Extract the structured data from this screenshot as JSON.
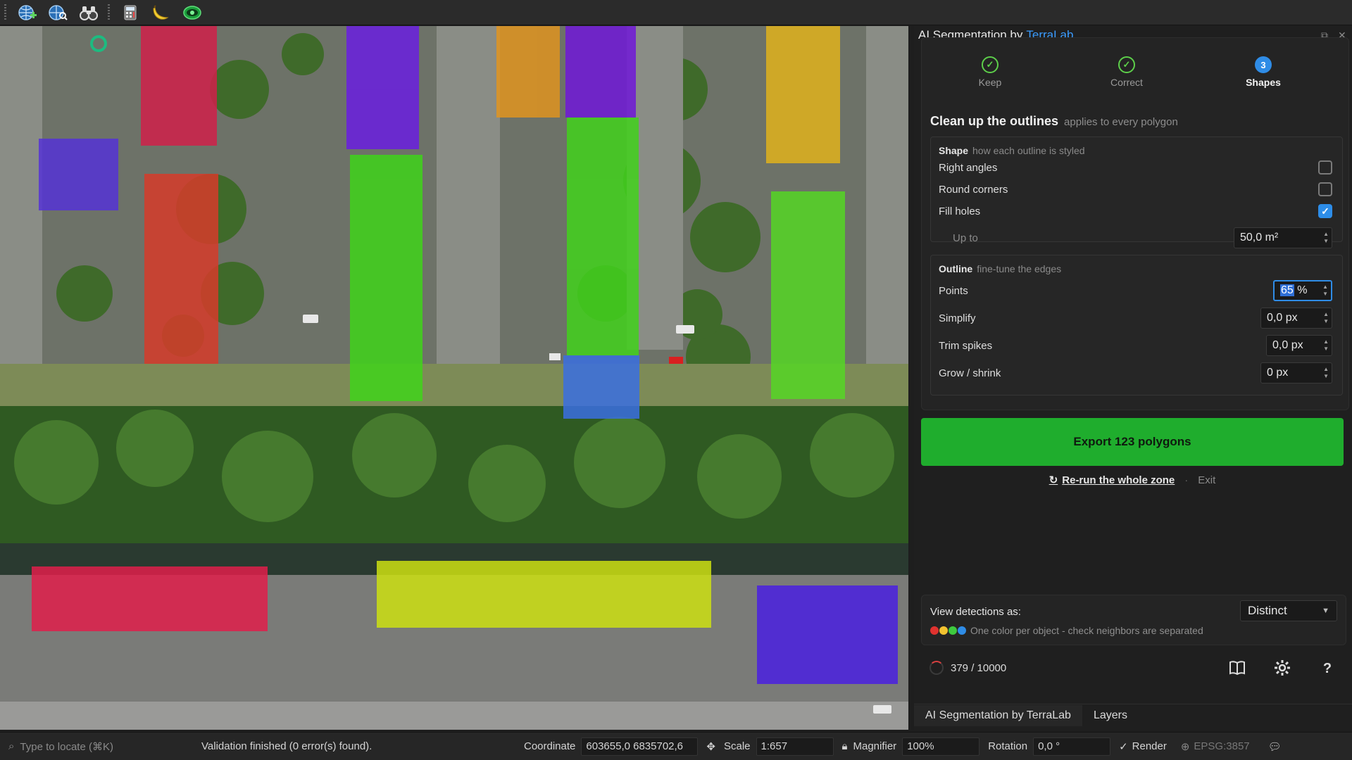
{
  "toolbar": {
    "icons": [
      "add-web-layer-icon",
      "search-web-layer-icon",
      "binoculars-icon",
      "calculator-icon",
      "banana-icon",
      "eye-plugin-icon"
    ]
  },
  "panel": {
    "title": "AI Segmentation by",
    "brand": "TerraLab",
    "steps": [
      {
        "label": "Keep",
        "state": "done"
      },
      {
        "label": "Correct",
        "state": "done"
      },
      {
        "label": "Shapes",
        "number": "3",
        "state": "active"
      }
    ],
    "section_title": "Clean up the outlines",
    "section_hint": "applies to every polygon",
    "shape": {
      "title": "Shape",
      "hint": "how each outline is styled",
      "right_angles": {
        "label": "Right angles",
        "checked": false
      },
      "round_corners": {
        "label": "Round corners",
        "checked": false
      },
      "fill_holes": {
        "label": "Fill holes",
        "checked": true
      },
      "up_to": {
        "label": "Up to",
        "value": "50,0 m²"
      }
    },
    "outline": {
      "title": "Outline",
      "hint": "fine-tune the edges",
      "points": {
        "label": "Points",
        "value": "65",
        "unit": "%"
      },
      "simplify": {
        "label": "Simplify",
        "value": "0,0 px"
      },
      "trim_spikes": {
        "label": "Trim spikes",
        "value": "0,0 px"
      },
      "grow_shrink": {
        "label": "Grow / shrink",
        "value": "0 px"
      }
    },
    "export_label": "Export 123 polygons",
    "rerun_label": "Re-run the whole zone",
    "exit_label": "Exit",
    "view": {
      "label": "View detections as:",
      "selected": "Distinct",
      "hint": "One color per object - check neighbors are separated",
      "dot_colors": [
        "#e0322f",
        "#f2c230",
        "#3ec93e",
        "#2f8ce6"
      ]
    },
    "usage": "379 / 10000",
    "dock_tabs": [
      "AI Segmentation by TerraLab",
      "Layers"
    ]
  },
  "statusbar": {
    "locate_placeholder": "Type to locate (⌘K)",
    "message": "Validation finished (0 error(s) found).",
    "coordinate_label": "Coordinate",
    "coordinate_value": "603655,0  6835702,6",
    "scale_label": "Scale",
    "scale_value": "1:657",
    "magnifier_label": "Magnifier",
    "magnifier_value": "100%",
    "rotation_label": "Rotation",
    "rotation_value": "0,0 °",
    "render_label": "Render",
    "crs": "EPSG:3857"
  }
}
